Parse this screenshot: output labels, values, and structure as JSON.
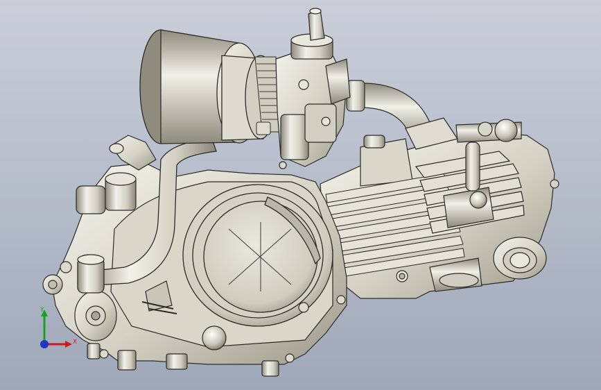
{
  "viewport": {
    "background_top": "#c9ced9",
    "background_bottom": "#9fa8b9"
  },
  "model": {
    "metal_light": "#ecebe2",
    "metal_mid": "#c7c5b6",
    "metal_dark": "#7d7a6c",
    "edge_color": "#2b2b26"
  },
  "triad": {
    "x_label": "X",
    "y_label": "Y",
    "z_label": "",
    "x_color": "#d01818",
    "y_color": "#1a9e25",
    "z_color": "#2036c4"
  }
}
